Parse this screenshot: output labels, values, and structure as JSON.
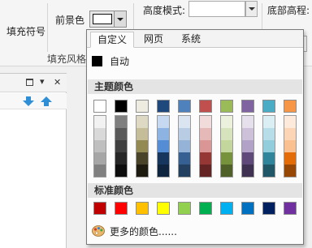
{
  "ribbon": {
    "fill_symbol_label": "填充符号",
    "foreground_label": "前景色",
    "height_mode_label": "高度模式:",
    "base_height_label": "底部高程:",
    "fill_style_group": "填充风格",
    "partial_label": "",
    "right_partial": "",
    "foreground_color": "#ffffff"
  },
  "popup": {
    "tabs": [
      "自定义",
      "网页",
      "系统"
    ],
    "auto_label": "自动",
    "theme_header": "主题颜色",
    "standard_header": "标准颜色",
    "more_colors_label": "更多的颜色......",
    "theme_colors": [
      "#ffffff",
      "#000000",
      "#eeece1",
      "#1f497d",
      "#4f81bd",
      "#c0504d",
      "#9bbb59",
      "#8064a2",
      "#4bacc6",
      "#f79646"
    ],
    "theme_shades": [
      [
        "#f2f2f2",
        "#d9d9d9",
        "#bfbfbf",
        "#a6a6a6",
        "#808080"
      ],
      [
        "#7f7f7f",
        "#595959",
        "#3f3f3f",
        "#262626",
        "#0d0d0d"
      ],
      [
        "#ddd9c3",
        "#c4bd97",
        "#938953",
        "#494429",
        "#1d1b10"
      ],
      [
        "#c6d9f0",
        "#8db3e2",
        "#548dd4",
        "#17365d",
        "#0f243e"
      ],
      [
        "#dbe5f1",
        "#b8cce4",
        "#95b3d7",
        "#366092",
        "#244061"
      ],
      [
        "#f2dcdb",
        "#e5b9b7",
        "#d99694",
        "#953734",
        "#632423"
      ],
      [
        "#ebf1dd",
        "#d7e3bc",
        "#c3d69b",
        "#76923c",
        "#4f6128"
      ],
      [
        "#e5e0ec",
        "#ccc1d9",
        "#b2a2c7",
        "#5f497a",
        "#3f3151"
      ],
      [
        "#dbeef3",
        "#b7dde8",
        "#92cddc",
        "#31859b",
        "#205867"
      ],
      [
        "#fdeada",
        "#fbd5b5",
        "#fac08f",
        "#e36c09",
        "#974806"
      ]
    ],
    "standard_colors": [
      "#c00000",
      "#ff0000",
      "#ffc000",
      "#ffff00",
      "#92d050",
      "#00b050",
      "#00b0f0",
      "#0070c0",
      "#002060",
      "#7030a0"
    ]
  },
  "left_pane": {
    "pin_icon": "pin-icon",
    "dropdown_icon": "dropdown-icon",
    "close_icon": "close-icon",
    "down_arrow_icon": "arrow-down-icon",
    "up_arrow_icon": "arrow-up-icon",
    "close_glyph": "✕",
    "dropdown_glyph": "▾"
  }
}
